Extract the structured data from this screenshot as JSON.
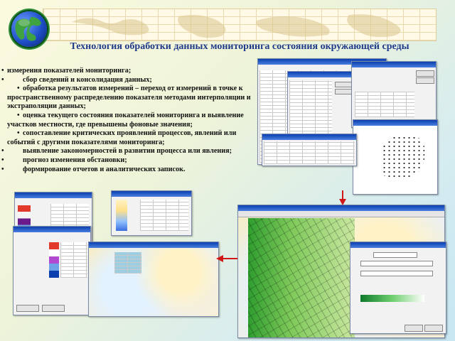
{
  "title": "Технология обработки данных мониторинга состояния окружающей среды",
  "bullets": [
    "измерения показателей мониторинга;",
    "сбор сведений и консолидация данных;",
    "обработка результатов измерений – переход от измерений в точке к пространственному распределению показателя методами интерполяции и экстраполяции данных;",
    "оценка текущего состояния показателей мониторинга и выявление участков местности, где превышены фоновые значения;",
    "сопоставление критических проявлений процессов, явлений или событий с другими показателями мониторинга;",
    "выявление закономерностей в развитии процесса или явления;",
    "прогноз изменения обстановки;",
    "формирование отчетов и аналитических записок."
  ],
  "colors": {
    "title": "#1f3a8a",
    "arrow": "#d01818",
    "accent_blue": "#0b3fae"
  },
  "icons": {
    "logo": "globe-icon",
    "arrow_down": "arrow-down-icon",
    "arrow_left": "arrow-left-icon"
  }
}
